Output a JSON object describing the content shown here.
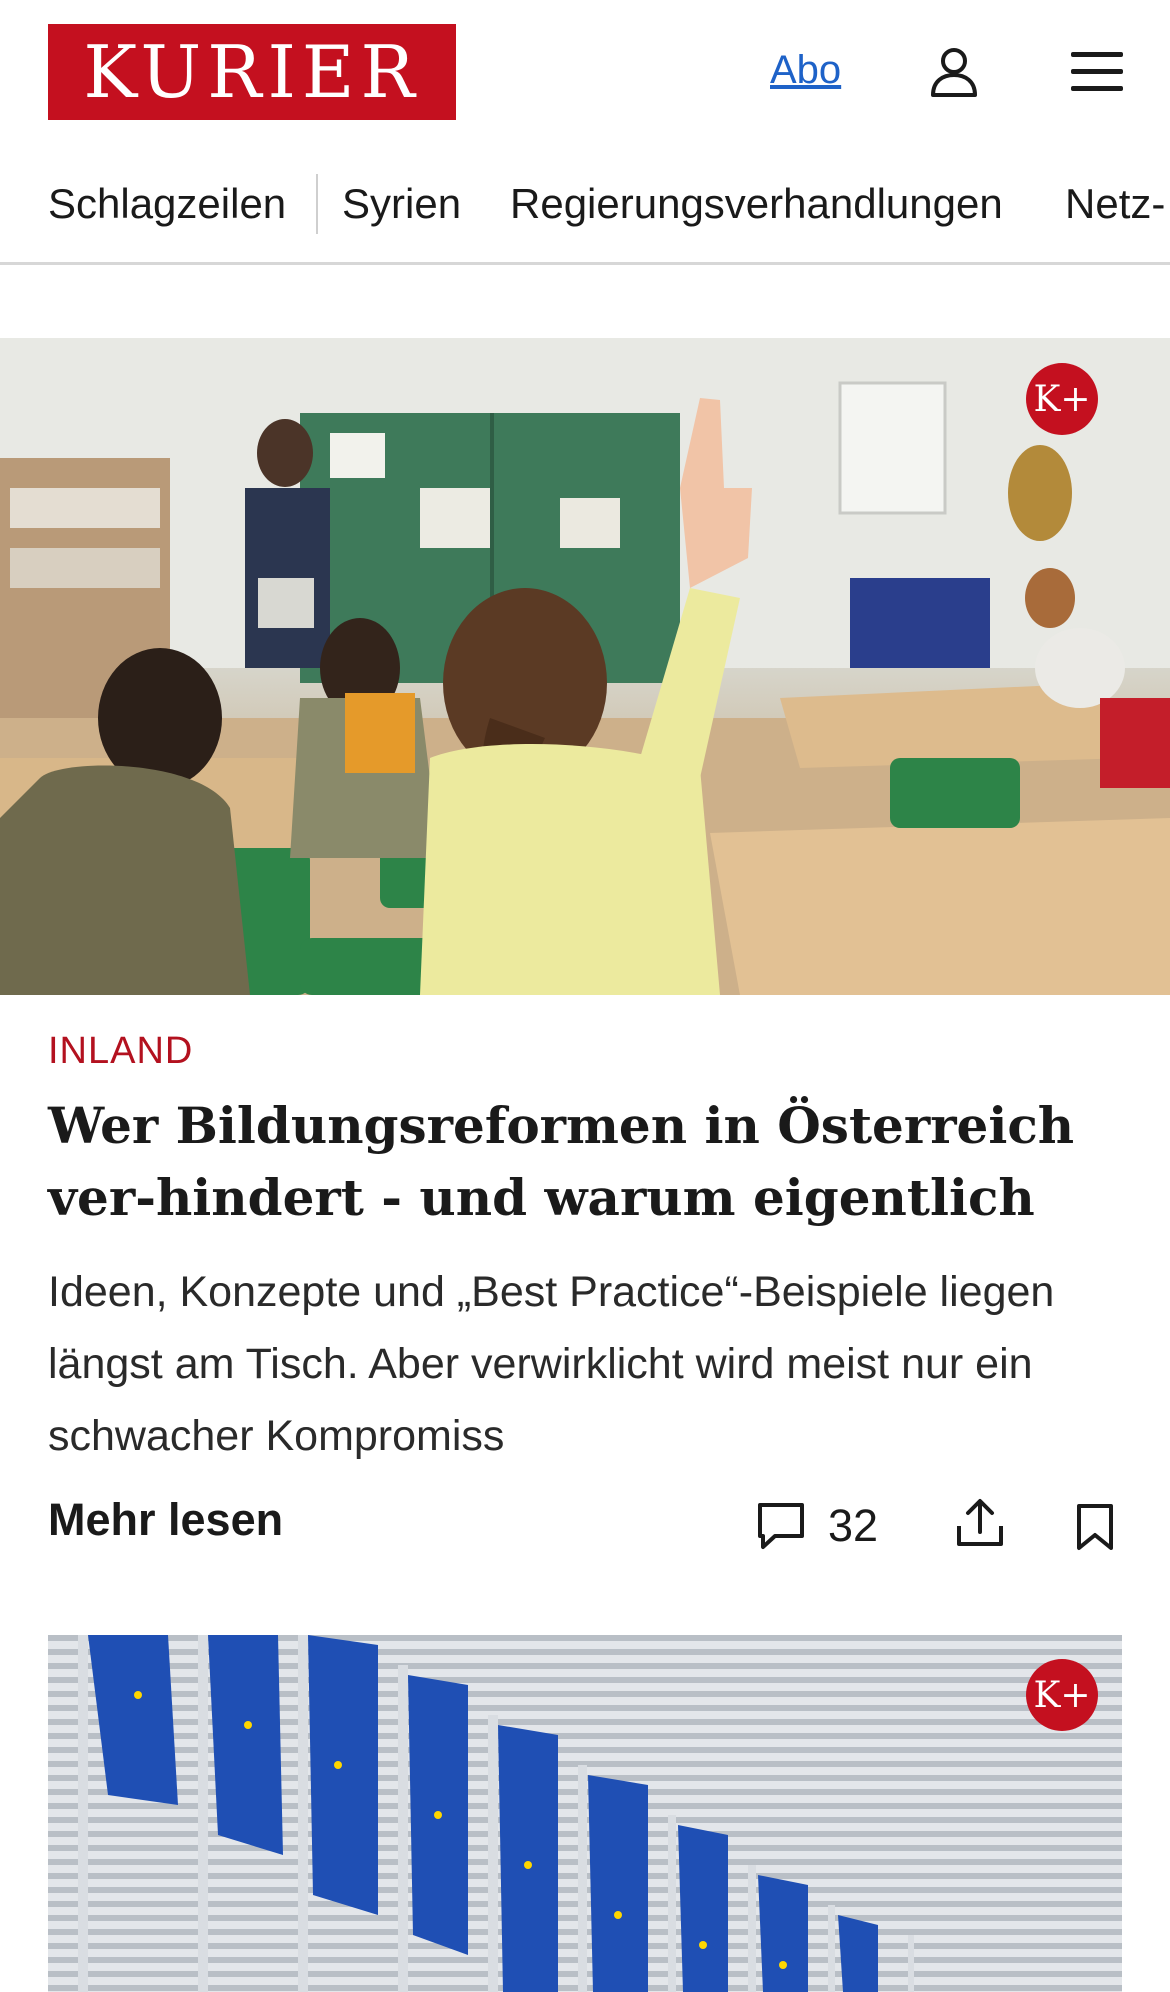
{
  "header": {
    "logo_text": "KURIER",
    "abo_label": "Abo",
    "brand_color": "#c4101f",
    "link_color": "#1e62c8"
  },
  "nav": {
    "items": [
      {
        "label": "Schlagzeilen"
      },
      {
        "label": "Syrien"
      },
      {
        "label": "Regierungsverhandlungen"
      },
      {
        "label": "Netz-"
      }
    ]
  },
  "article": {
    "badge": "K+",
    "category": "INLAND",
    "headline": "Wer Bildungsreformen in Österreich ver-hindert - und warum eigentlich",
    "teaser": "Ideen, Konzepte und „Best Practice“-Beispiele liegen längst am Tisch. Aber verwirklicht wird meist nur ein schwacher Kompromiss",
    "more_label": "Mehr lesen",
    "comment_count": "32"
  },
  "second_article": {
    "badge": "K+"
  },
  "icons": [
    "user-icon",
    "menu-icon",
    "comment-icon",
    "share-icon",
    "bookmark-icon"
  ]
}
